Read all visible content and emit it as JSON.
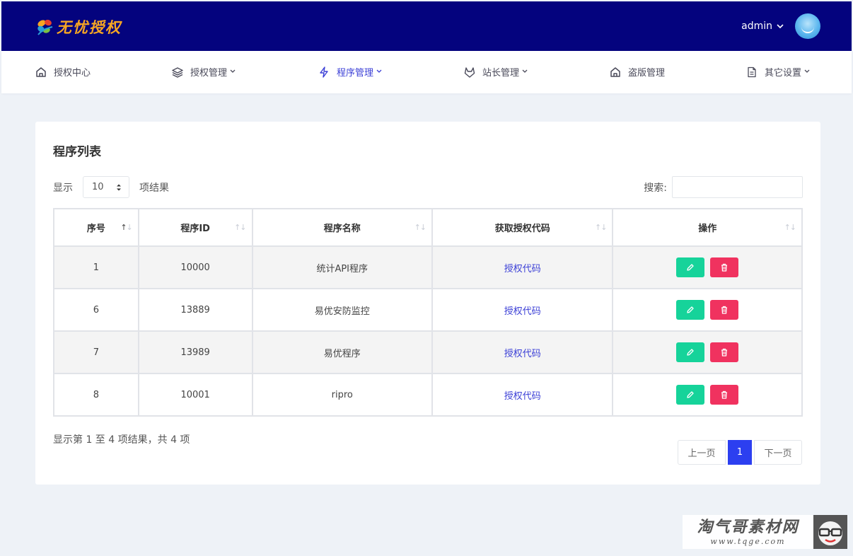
{
  "header": {
    "logo_text": "无忧授权",
    "user_name": "admin"
  },
  "nav": [
    {
      "label": "授权中心",
      "icon": "home-icon"
    },
    {
      "label": "授权管理",
      "icon": "layers-icon",
      "has_dropdown": true
    },
    {
      "label": "程序管理",
      "icon": "lightning-icon",
      "has_dropdown": true,
      "active": true
    },
    {
      "label": "站长管理",
      "icon": "gitlab-icon",
      "has_dropdown": true
    },
    {
      "label": "盗版管理",
      "icon": "home-icon"
    },
    {
      "label": "其它设置",
      "icon": "file-icon",
      "has_dropdown": true
    }
  ],
  "card": {
    "title": "程序列表",
    "length_prefix": "显示",
    "length_value": "10",
    "length_suffix": "项结果",
    "search_label": "搜索:",
    "search_value": ""
  },
  "table": {
    "columns": [
      "序号",
      "程序ID",
      "程序名称",
      "获取授权代码",
      "操作"
    ],
    "rows": [
      {
        "index": "1",
        "id": "10000",
        "name": "统计API程序",
        "code": "授权代码"
      },
      {
        "index": "6",
        "id": "13889",
        "name": "易优安防监控",
        "code": "授权代码"
      },
      {
        "index": "7",
        "id": "13989",
        "name": "易优程序",
        "code": "授权代码"
      },
      {
        "index": "8",
        "id": "10001",
        "name": "ripro",
        "code": "授权代码"
      }
    ]
  },
  "footer": {
    "info": "显示第 1 至 4 项结果，共 4 项",
    "prev": "上一页",
    "page": "1",
    "next": "下一页"
  },
  "watermark": {
    "main": "淘气哥素材网",
    "sub": "www.tqge.com"
  },
  "colors": {
    "header_bg": "#04037e",
    "accent": "#3b3fd6",
    "edit_btn": "#16d39a",
    "delete_btn": "#f0325f",
    "page_active": "#2c3ff0"
  }
}
